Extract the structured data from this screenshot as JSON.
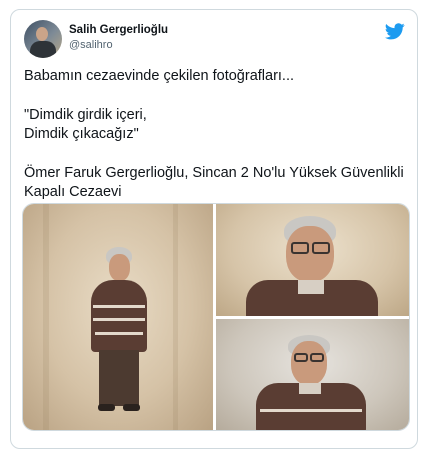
{
  "author": {
    "name": "Salih Gergerlioğlu",
    "handle": "@salihro"
  },
  "icons": {
    "platform": "twitter-bird-icon",
    "platform_color": "#1d9bf0"
  },
  "tweet": {
    "line1": "Babamın cezaevinde çekilen fotoğrafları...",
    "quote_line1": "\"Dimdik girdik içeri,",
    "quote_line2": "Dimdik çıkacağız\"",
    "caption": "Ömer Faruk Gergerlioğlu, Sincan 2 No'lu Yüksek Güvenlikli Kapalı Cezaevi"
  },
  "media": {
    "photo_count": 3
  }
}
